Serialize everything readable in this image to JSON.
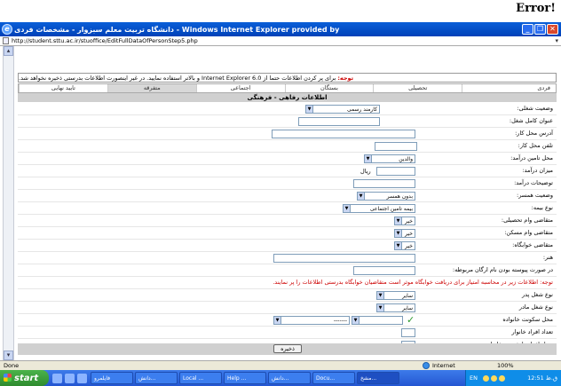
{
  "error_label": "Error!",
  "window": {
    "title": "دانشگاه تربیت معلم سبزوار - مشخصات فردی - Windows Internet Explorer provided by",
    "address": "http://student.sttu.ac.ir/stuoffice/EditFullDataOfPersonStep5.php",
    "buttons": [
      "_",
      "❐",
      "✕"
    ]
  },
  "notice": {
    "prefix": "توجه:",
    "text": "برای پر کردن اطلاعات حتما از Internet Explorer 6.0 و بالاتر استفاده نمایید. در غیر اینصورت اطلاعات بدرستی ذخیره نخواهد شد."
  },
  "tabs": [
    "فردی",
    "تحصیلی",
    "بستگان",
    "اجتماعی",
    "متفرقه",
    "تایید نهایی"
  ],
  "active_tab": 4,
  "section_title": "اطلاعات رفاهی - فرهنگی",
  "form": {
    "job_status": {
      "label": "وضعیت شغلی:",
      "value": "کارمند رسمی"
    },
    "job_title": {
      "label": "عنوان کامل شغل:"
    },
    "work_address": {
      "label": "آدرس محل کار:"
    },
    "work_phone": {
      "label": "تلفن محل کار:"
    },
    "income_source": {
      "label": "محل تامین درآمد:",
      "value": "والدین"
    },
    "income_amount": {
      "label": "میزان درآمد:",
      "unit": "ریال"
    },
    "income_desc": {
      "label": "توضیحات درآمد:"
    },
    "spouse_status": {
      "label": "وضعیت همسر:",
      "value": "بدون همسر"
    },
    "insurance_type": {
      "label": "نوع بیمه:",
      "value": "بیمه تامین اجتماعی"
    },
    "edu_loan": {
      "label": "متقاضی وام تحصیلی:",
      "value": "خیر"
    },
    "housing_loan": {
      "label": "متقاضی وام مسکن:",
      "value": "خیر"
    },
    "dorm_applicant": {
      "label": "متقاضی خوابگاه:",
      "value": "خیر"
    },
    "art": {
      "label": "هنر:"
    },
    "org_name": {
      "label": "در صورت پیوسته بودن نام ارگان مربوطه:"
    },
    "dorm_note": "توجه: اطلاعات زیر در محاسبه امتیاز برای دریافت خوابگاه موثر است متقاضیان خوابگاه بدرستی اطلاعات را پر نمایند.",
    "father_job": {
      "label": "نوع شغل پدر",
      "value": "سایر"
    },
    "mother_job": {
      "label": "نوع شغل مادر",
      "value": "سایر"
    },
    "family_residence": {
      "label": "محل سکونت خانواده",
      "value": "-------"
    },
    "family_count": {
      "label": "تعداد افراد خانوار"
    },
    "student_count": {
      "label": "تعداد افراد دانشجوی خانوار"
    }
  },
  "save_label": "ذخیره",
  "status": {
    "left": "Done",
    "zone": "Internet",
    "zoom": "100%"
  },
  "taskbar": {
    "start": "start",
    "tasks": [
      "فایلمرو",
      "دانش...",
      "Local ...",
      "Help ...",
      "دانش...",
      "Docu...",
      "مشخ..."
    ],
    "lang": "EN",
    "clock": "12:51 ق.ظ"
  }
}
